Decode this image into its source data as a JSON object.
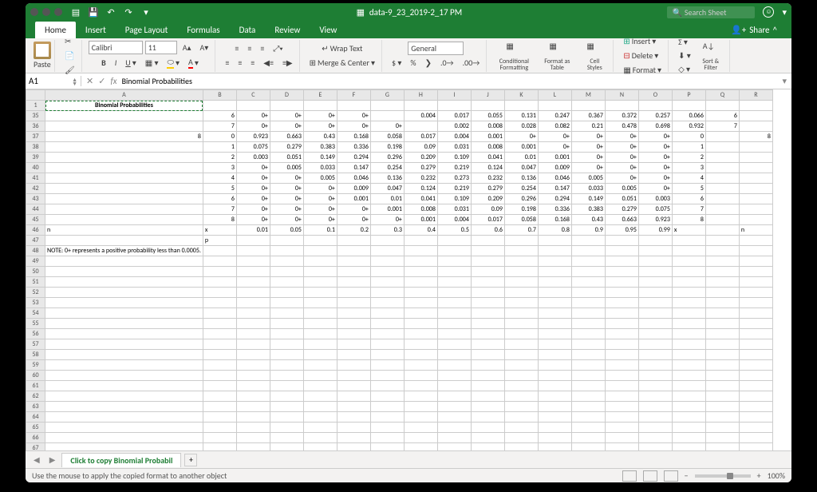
{
  "titlebar": {
    "filename": "data-9_23_2019-2_17 PM",
    "search_placeholder": "Search Sheet"
  },
  "ribbonTabs": {
    "items": [
      "Home",
      "Insert",
      "Page Layout",
      "Formulas",
      "Data",
      "Review",
      "View"
    ],
    "active": 0,
    "share": "Share"
  },
  "ribbon": {
    "paste": "Paste",
    "font": "Calibri",
    "size": "11",
    "wrap": "Wrap Text",
    "merge": "Merge & Center",
    "numfmt": "General",
    "condfmt": "Conditional Formatting",
    "fmttbl": "Format as Table",
    "cellstyles": "Cell Styles",
    "insert": "Insert",
    "delete": "Delete",
    "format": "Format",
    "sortfilter": "Sort & Filter"
  },
  "namebox": "A1",
  "formula": "Binomial Probabilities",
  "columns": [
    "A",
    "B",
    "C",
    "D",
    "E",
    "F",
    "G",
    "H",
    "I",
    "J",
    "K",
    "L",
    "M",
    "N",
    "O",
    "P",
    "Q",
    "R"
  ],
  "row1_label": "Binomial Probabilities",
  "rows": [
    {
      "n": 35,
      "v": [
        null,
        "6",
        "0+",
        "0+",
        "0+",
        "0+",
        "",
        "0.004",
        "0.017",
        "0.055",
        "0.131",
        "0.247",
        "0.367",
        "0.372",
        "0.257",
        "0.066",
        "6",
        ""
      ]
    },
    {
      "n": 36,
      "v": [
        null,
        "7",
        "0+",
        "0+",
        "0+",
        "0+",
        "0+",
        "",
        "0.002",
        "0.008",
        "0.028",
        "0.082",
        "0.21",
        "0.478",
        "0.698",
        "0.932",
        "7",
        ""
      ]
    },
    {
      "n": 37,
      "v": [
        "8",
        "0",
        "0.923",
        "0.663",
        "0.43",
        "0.168",
        "0.058",
        "0.017",
        "0.004",
        "0.001",
        "0+",
        "0+",
        "0+",
        "0+",
        "0+",
        "0",
        "",
        "8"
      ]
    },
    {
      "n": 38,
      "v": [
        null,
        "1",
        "0.075",
        "0.279",
        "0.383",
        "0.336",
        "0.198",
        "0.09",
        "0.031",
        "0.008",
        "0.001",
        "0+",
        "0+",
        "0+",
        "0+",
        "1",
        ""
      ]
    },
    {
      "n": 39,
      "v": [
        null,
        "2",
        "0.003",
        "0.051",
        "0.149",
        "0.294",
        "0.296",
        "0.209",
        "0.109",
        "0.041",
        "0.01",
        "0.001",
        "0+",
        "0+",
        "0+",
        "2",
        ""
      ]
    },
    {
      "n": 40,
      "v": [
        null,
        "3",
        "0+",
        "0.005",
        "0.033",
        "0.147",
        "0.254",
        "0.279",
        "0.219",
        "0.124",
        "0.047",
        "0.009",
        "0+",
        "0+",
        "0+",
        "3",
        ""
      ]
    },
    {
      "n": 41,
      "v": [
        null,
        "4",
        "0+",
        "0+",
        "0.005",
        "0.046",
        "0.136",
        "0.232",
        "0.273",
        "0.232",
        "0.136",
        "0.046",
        "0.005",
        "0+",
        "0+",
        "4",
        ""
      ]
    },
    {
      "n": 42,
      "v": [
        null,
        "5",
        "0+",
        "0+",
        "0+",
        "0.009",
        "0.047",
        "0.124",
        "0.219",
        "0.279",
        "0.254",
        "0.147",
        "0.033",
        "0.005",
        "0+",
        "5",
        ""
      ]
    },
    {
      "n": 43,
      "v": [
        null,
        "6",
        "0+",
        "0+",
        "0+",
        "0.001",
        "0.01",
        "0.041",
        "0.109",
        "0.209",
        "0.296",
        "0.294",
        "0.149",
        "0.051",
        "0.003",
        "6",
        ""
      ]
    },
    {
      "n": 44,
      "v": [
        null,
        "7",
        "0+",
        "0+",
        "0+",
        "0+",
        "0.001",
        "0.008",
        "0.031",
        "0.09",
        "0.198",
        "0.336",
        "0.383",
        "0.279",
        "0.075",
        "7",
        ""
      ]
    },
    {
      "n": 45,
      "v": [
        null,
        "8",
        "0+",
        "0+",
        "0+",
        "0+",
        "0+",
        "0.001",
        "0.004",
        "0.017",
        "0.058",
        "0.168",
        "0.43",
        "0.663",
        "0.923",
        "8",
        ""
      ]
    },
    {
      "n": 46,
      "v": [
        "n",
        "x",
        "0.01",
        "0.05",
        "0.1",
        "0.2",
        "0.3",
        "0.4",
        "0.5",
        "0.6",
        "0.7",
        "0.8",
        "0.9",
        "0.95",
        "0.99",
        "x",
        "",
        "n"
      ]
    },
    {
      "n": 47,
      "v": [
        null,
        "p",
        "",
        "",
        "",
        "",
        "",
        "",
        "",
        "",
        "",
        "",
        "",
        "",
        "",
        "",
        "",
        ""
      ]
    }
  ],
  "note_row": 48,
  "note": "NOTE: 0+ represents a positive probability less than 0.0005.",
  "empty_rows": [
    49,
    50,
    51,
    52,
    53,
    54,
    55,
    56,
    57,
    58,
    59,
    60,
    61,
    62,
    63,
    64,
    65,
    66,
    67
  ],
  "sheetTab": "Click to copy Binomial Probabil",
  "status": "Use the mouse to apply the copied format to another object",
  "zoom": "100%"
}
